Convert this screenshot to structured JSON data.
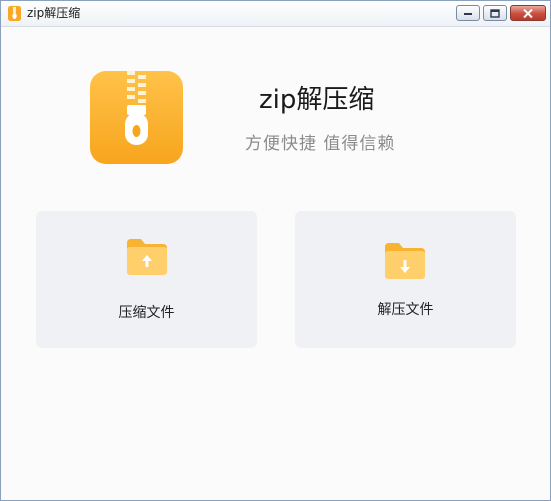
{
  "window": {
    "title": "zip解压缩",
    "controls": [
      "minimize",
      "maximize",
      "close"
    ]
  },
  "app": {
    "name": "zip解压缩",
    "tagline": "方便快捷 值得信赖",
    "logo_icon": "zipper-icon"
  },
  "actions": {
    "compress": {
      "label": "压缩文件",
      "icon": "folder-upload-icon"
    },
    "extract": {
      "label": "解压文件",
      "icon": "folder-download-icon"
    }
  },
  "colors": {
    "accent_orange": "#fbb03b",
    "card_bg": "#f0f1f5",
    "close_red": "#c94f3f"
  }
}
